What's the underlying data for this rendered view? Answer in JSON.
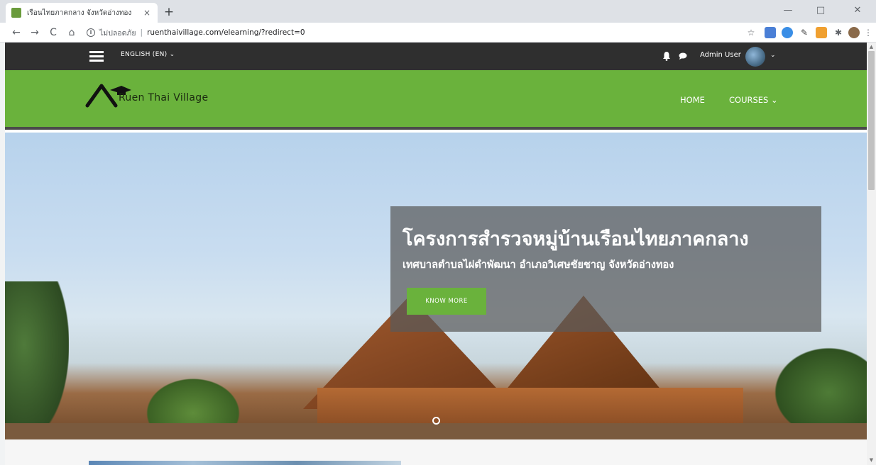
{
  "browser": {
    "tab_title": "เรือนไทยภาคกลาง จังหวัดอ่างทอง",
    "tab_close": "×",
    "new_tab": "+",
    "security_label": "ไม่ปลอดภัย",
    "url_separator": "|",
    "url": "ruenthaivillage.com/elearning/?redirect=0",
    "back": "←",
    "forward": "→",
    "reload": "C",
    "home": "⌂",
    "star": "☆",
    "minimize": "—",
    "maximize": "□",
    "close": "✕",
    "menu": "⋮"
  },
  "topbar": {
    "language": "ENGLISH (EN) ⌄",
    "user_name": "Admin User",
    "avatar_caret": "⌄"
  },
  "header": {
    "site_name": "Ruen Thai Village",
    "nav": {
      "home": "HOME",
      "courses": "COURSES ⌄"
    }
  },
  "hero": {
    "title": "โครงการสำรวจหมู่บ้านเรือนไทยภาคกลาง",
    "subtitle": "เทศบาลตำบลไผ่ดำพัฒนา อำเภอวิเศษชัยชาญ จังหวัดอ่างทอง",
    "button_label": "KNOW MORE"
  },
  "colors": {
    "brand_green": "#6ab23c",
    "topbar_dark": "#2f2f2f"
  }
}
